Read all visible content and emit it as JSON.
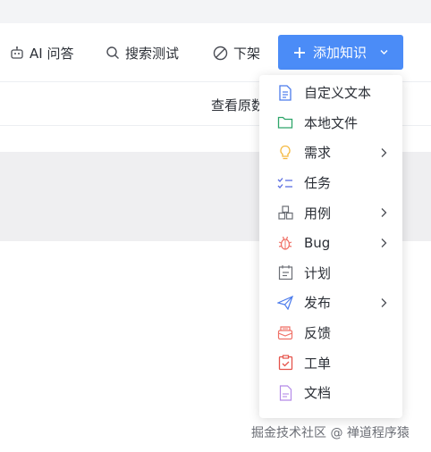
{
  "toolbar": {
    "ai_label": "AI 问答",
    "search_label": "搜索测试",
    "offline_label": "下架",
    "add_label": "添加知识"
  },
  "subheader": {
    "view_raw_label": "查看原数"
  },
  "menu": {
    "items": [
      {
        "label": "自定义文本",
        "icon": "document-icon",
        "has_submenu": false,
        "color": "#4b7bec"
      },
      {
        "label": "本地文件",
        "icon": "folder-icon",
        "has_submenu": false,
        "color": "#2ea56a"
      },
      {
        "label": "需求",
        "icon": "lightbulb-icon",
        "has_submenu": true,
        "color": "#f5b83d"
      },
      {
        "label": "任务",
        "icon": "checklist-icon",
        "has_submenu": false,
        "color": "#5b6ee1"
      },
      {
        "label": "用例",
        "icon": "cases-icon",
        "has_submenu": true,
        "color": "#6b6e75"
      },
      {
        "label": "Bug",
        "icon": "bug-icon",
        "has_submenu": true,
        "color": "#f07167"
      },
      {
        "label": "计划",
        "icon": "plan-icon",
        "has_submenu": false,
        "color": "#6b6e75"
      },
      {
        "label": "发布",
        "icon": "send-icon",
        "has_submenu": true,
        "color": "#4b7bec"
      },
      {
        "label": "反馈",
        "icon": "feedback-icon",
        "has_submenu": false,
        "color": "#f07167"
      },
      {
        "label": "工单",
        "icon": "ticket-icon",
        "has_submenu": false,
        "color": "#e5534b"
      },
      {
        "label": "文档",
        "icon": "file-icon",
        "has_submenu": false,
        "color": "#b48ae8"
      }
    ]
  },
  "watermark": "掘金技术社区 @ 禅道程序猿"
}
